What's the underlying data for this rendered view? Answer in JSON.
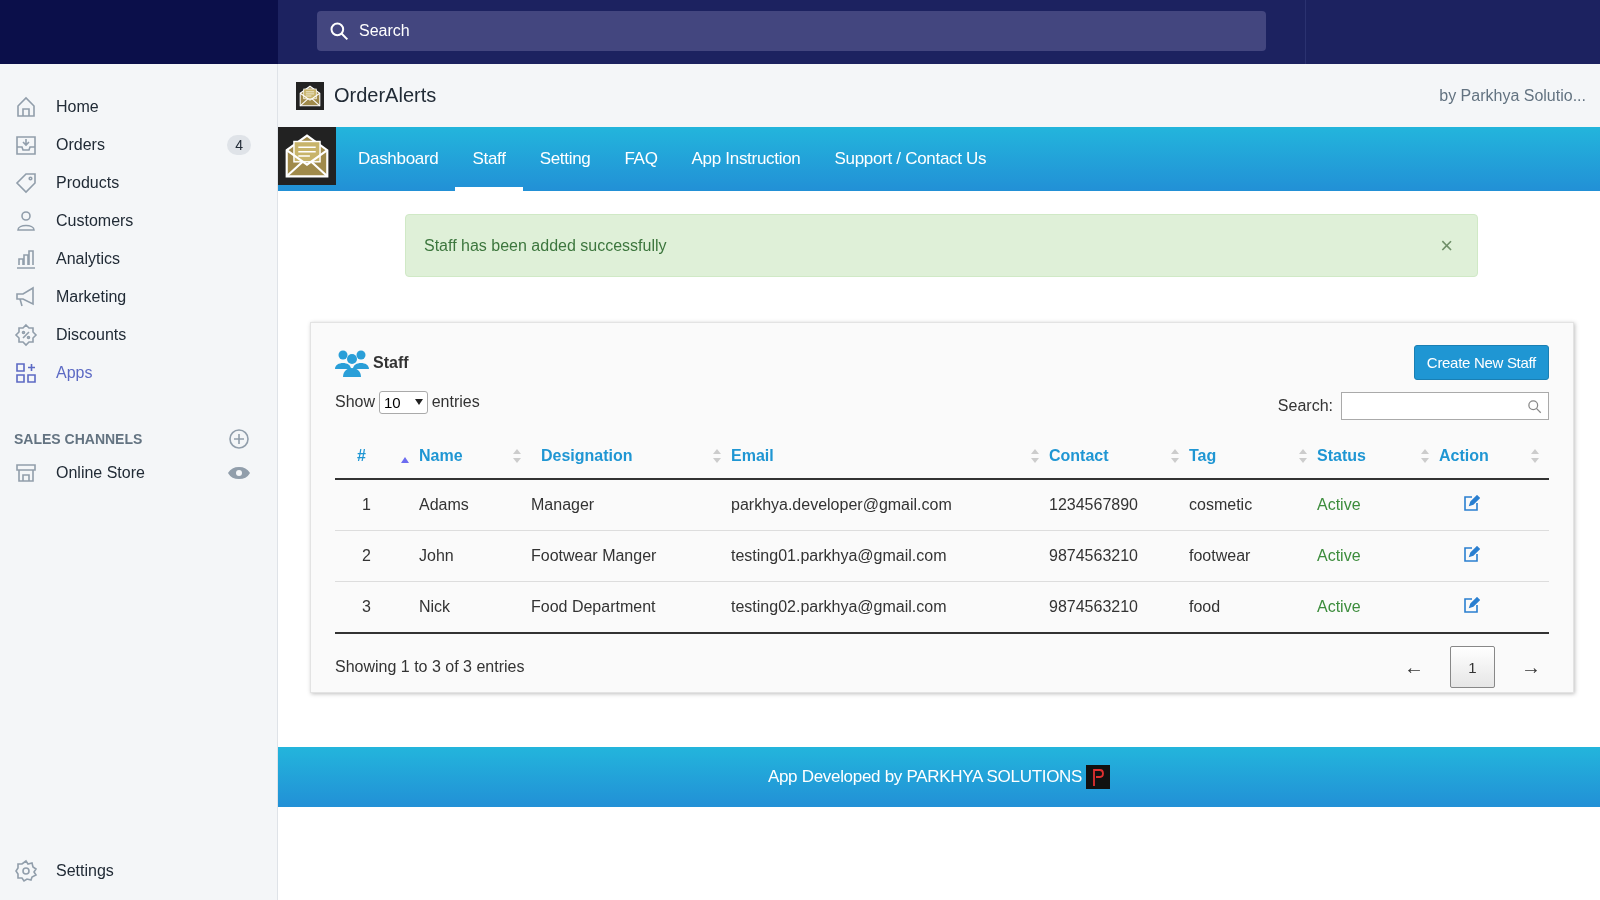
{
  "topbar": {
    "search": {
      "placeholder": "Search"
    }
  },
  "sidebar": {
    "items": [
      {
        "label": "Home",
        "selected": false
      },
      {
        "label": "Orders",
        "selected": false,
        "badge": "4"
      },
      {
        "label": "Products",
        "selected": false
      },
      {
        "label": "Customers",
        "selected": false
      },
      {
        "label": "Analytics",
        "selected": false
      },
      {
        "label": "Marketing",
        "selected": false
      },
      {
        "label": "Discounts",
        "selected": false
      },
      {
        "label": "Apps",
        "selected": true
      }
    ],
    "section_title": "SALES CHANNELS",
    "channels": [
      {
        "label": "Online Store"
      }
    ],
    "footer_item": {
      "label": "Settings"
    }
  },
  "app_header": {
    "title": "OrderAlerts",
    "byline": "by Parkhya Solutio..."
  },
  "tabs": [
    {
      "label": "Dashboard",
      "selected": false
    },
    {
      "label": "Staff",
      "selected": true
    },
    {
      "label": "Setting",
      "selected": false
    },
    {
      "label": "FAQ",
      "selected": false
    },
    {
      "label": "App Instruction",
      "selected": false
    },
    {
      "label": "Support / Contact Us",
      "selected": false
    }
  ],
  "alert": {
    "message": "Staff has been added successfully",
    "close": "×"
  },
  "panel": {
    "title": "Staff",
    "create_button": "Create New Staff",
    "show_label": "Show",
    "page_size": "10",
    "entries_label": "entries",
    "search_label": "Search:",
    "table": {
      "columns": [
        {
          "label": "#",
          "sorted": true
        },
        {
          "label": "Name",
          "sorted": false
        },
        {
          "label": "Designation",
          "sorted": false
        },
        {
          "label": "Email",
          "sorted": false
        },
        {
          "label": "Contact",
          "sorted": false
        },
        {
          "label": "Tag",
          "sorted": false
        },
        {
          "label": "Status",
          "sorted": false
        },
        {
          "label": "Action",
          "sorted": false
        }
      ],
      "rows": [
        {
          "cells": [
            "1",
            "Adams",
            "Manager",
            "parkhya.developer@gmail.com",
            "1234567890",
            "cosmetic",
            "Active"
          ]
        },
        {
          "cells": [
            "2",
            "John",
            "Footwear Manger",
            "testing01.parkhya@gmail.com",
            "9874563210",
            "footwear",
            "Active"
          ]
        },
        {
          "cells": [
            "3",
            "Nick",
            "Food Department",
            "testing02.parkhya@gmail.com",
            "9874563210",
            "food",
            "Active"
          ]
        }
      ]
    },
    "info": "Showing 1 to 3 of 3 entries",
    "pagination": {
      "prev": "←",
      "pages": [
        {
          "label": "1",
          "selected": true
        }
      ],
      "next": "→"
    }
  },
  "footer": {
    "text": "App Developed by PARKHYA SOLUTIONS"
  }
}
